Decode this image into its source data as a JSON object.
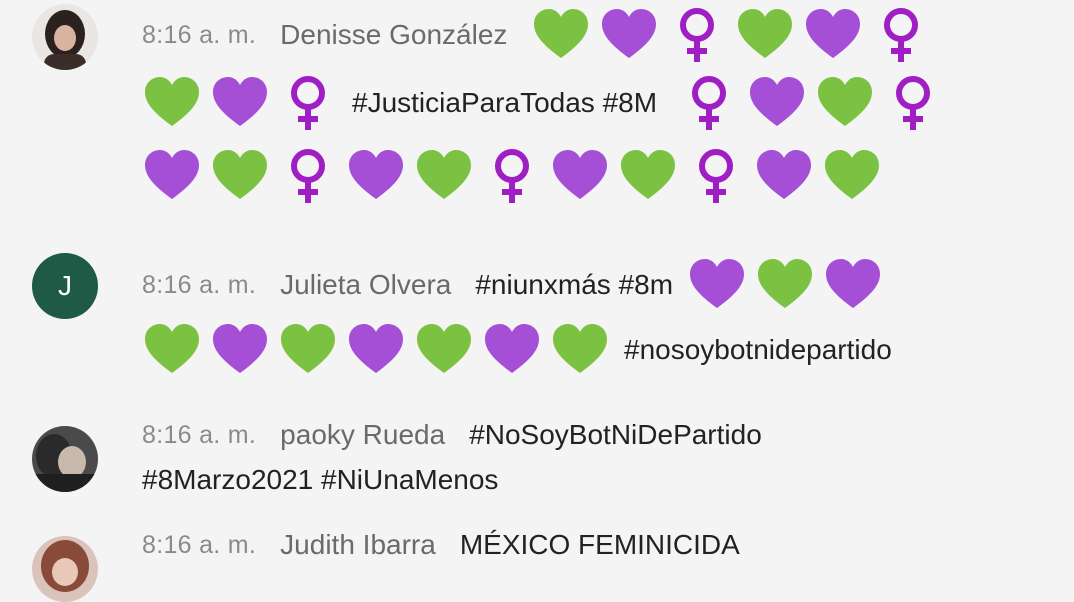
{
  "messages": [
    {
      "time": "8:16 a. m.",
      "author": "Denisse González",
      "avatar": "photo-avatar-woman",
      "lines": [
        {
          "emojis": [
            "green-heart",
            "purple-heart",
            "female-sign",
            "green-heart",
            "purple-heart",
            "female-sign"
          ]
        },
        {
          "emojis": [
            "green-heart",
            "purple-heart",
            "female-sign"
          ],
          "text": "#JusticiaParaTodas #8M",
          "emojis_after": [
            "female-sign",
            "purple-heart",
            "green-heart",
            "female-sign"
          ]
        },
        {
          "emojis": [
            "purple-heart",
            "green-heart",
            "female-sign",
            "purple-heart",
            "green-heart",
            "female-sign",
            "purple-heart",
            "green-heart",
            "female-sign",
            "purple-heart",
            "green-heart"
          ]
        }
      ]
    },
    {
      "time": "8:16 a. m.",
      "author": "Julieta Olvera",
      "avatar_letter": "J",
      "lines": [
        {
          "text": "#niunxmás #8m",
          "emojis_after": [
            "purple-heart",
            "green-heart",
            "purple-heart"
          ]
        },
        {
          "emojis": [
            "green-heart",
            "purple-heart",
            "green-heart",
            "purple-heart",
            "green-heart",
            "purple-heart",
            "green-heart"
          ],
          "text_after": "#nosoybotnidepartido"
        }
      ]
    },
    {
      "time": "8:16 a. m.",
      "author": "paoky Rueda",
      "avatar": "photo-avatar-dark",
      "lines": [
        {
          "text": "#NoSoyBotNiDePartido"
        },
        {
          "text": "#8Marzo2021 #NiUnaMenos"
        }
      ]
    },
    {
      "time": "8:16 a. m.",
      "author": "Judith Ibarra",
      "avatar": "photo-avatar-woman-2",
      "lines": [
        {
          "text": "MÉXICO FEMINICIDA"
        }
      ]
    }
  ],
  "colors": {
    "green_heart": "#7cc242",
    "purple_heart": "#a44fd6",
    "female_sign": "#a01fc4",
    "letter_avatar_bg": "#1e5a45"
  }
}
